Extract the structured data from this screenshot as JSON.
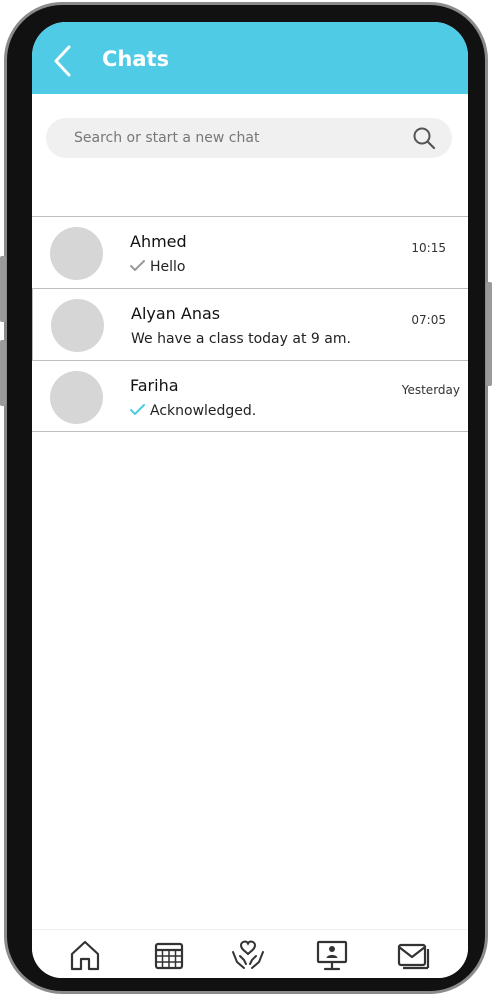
{
  "header": {
    "title": "Chats",
    "back_icon": "chevron-left-icon",
    "color": "#4fcbe6"
  },
  "search": {
    "placeholder": "Search or start a new chat",
    "icon": "search-icon"
  },
  "chats": [
    {
      "name": "Ahmed",
      "last_message": "Hello",
      "time": "10:15",
      "status": "sent",
      "tick_color": "#9a9a9a"
    },
    {
      "name": "Alyan Anas",
      "last_message": "We have a class today at 9 am.",
      "time": "07:05",
      "status": "received"
    },
    {
      "name": "Fariha",
      "last_message": "Acknowledged.",
      "time": "Yesterday",
      "status": "read",
      "tick_color": "#4fcbe6"
    }
  ],
  "tabbar": {
    "items": [
      {
        "icon": "home-icon"
      },
      {
        "icon": "calendar-icon"
      },
      {
        "icon": "care-hands-heart-icon"
      },
      {
        "icon": "presentation-board-icon"
      },
      {
        "icon": "mail-icon"
      }
    ]
  }
}
